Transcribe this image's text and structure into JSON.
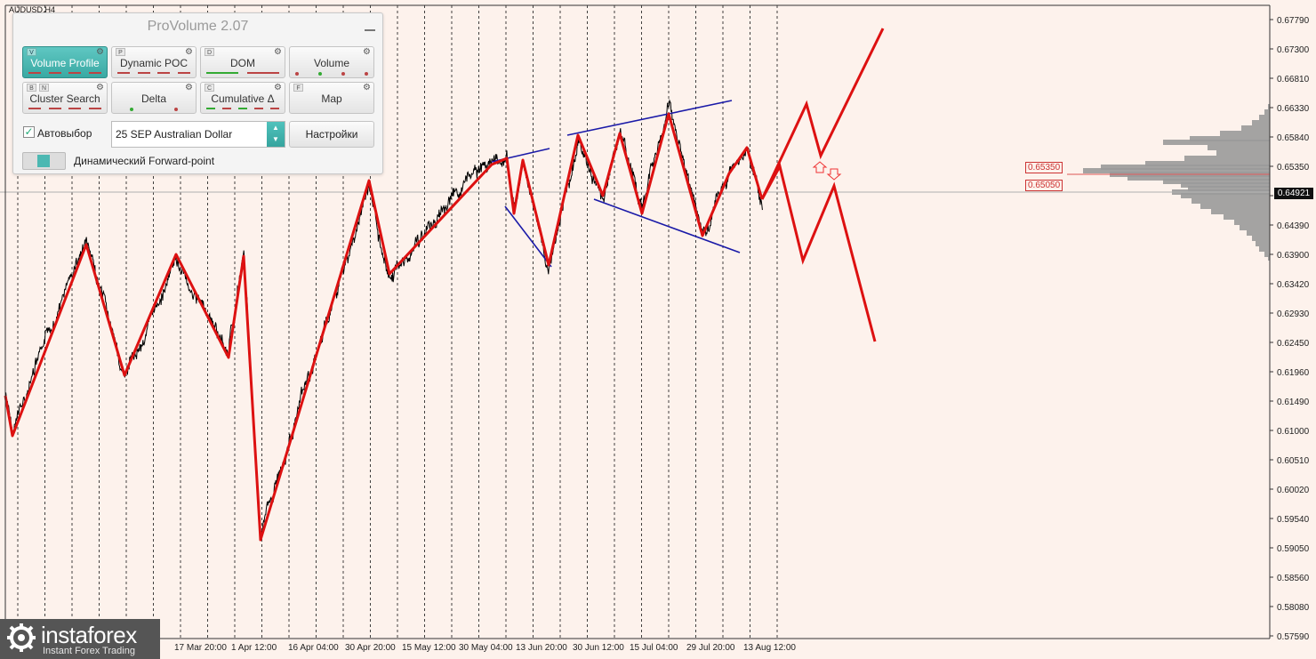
{
  "chart": {
    "symbol": "AUDUSD,H4",
    "background": "#fdf2ec",
    "price_scale": [
      "0.67790",
      "0.67300",
      "0.66810",
      "0.66330",
      "0.65840",
      "0.65350",
      "0.64870",
      "0.64390",
      "0.63900",
      "0.63420",
      "0.62930",
      "0.62450",
      "0.61960",
      "0.61490",
      "0.61000",
      "0.60510",
      "0.60020",
      "0.59540",
      "0.59050",
      "0.58560",
      "0.58080",
      "0.57590"
    ],
    "date_labels": [
      "17 Mar 20:00",
      "1 Apr 12:00",
      "16 Apr 04:00",
      "30 Apr 20:00",
      "15 May 12:00",
      "30 May 04:00",
      "13 Jun 20:00",
      "30 Jun 12:00",
      "15 Jul 04:00",
      "29 Jul 20:00",
      "13 Aug 12:00"
    ],
    "current_price": "0.64921",
    "level_upper": "0.65350",
    "level_lower": "0.65050",
    "colors": {
      "zigzag": "#dd1111",
      "channel": "#1a1aa8",
      "volume_profile": "#9a9a9a",
      "price": "#000000"
    }
  },
  "panel": {
    "title": "ProVolume 2.07",
    "buttons": [
      {
        "label": "Volume Profile",
        "key": "V"
      },
      {
        "label": "Dynamic POC",
        "key": "P"
      },
      {
        "label": "DOM",
        "key": "D"
      },
      {
        "label": "Volume",
        "key": ""
      },
      {
        "label": "Cluster Search",
        "key": "B",
        "key2": "N"
      },
      {
        "label": "Delta",
        "key": ""
      },
      {
        "label": "Cumulative Δ",
        "key": "C"
      },
      {
        "label": "Map",
        "key": "F"
      }
    ],
    "auto_label": "Автовыбор",
    "symbol_value": "25 SEP Australian Dollar",
    "settings_label": "Настройки",
    "forward_label": "Динамический Forward-point"
  },
  "logo": {
    "name": "instaforex",
    "tagline": "Instant Forex Trading"
  }
}
